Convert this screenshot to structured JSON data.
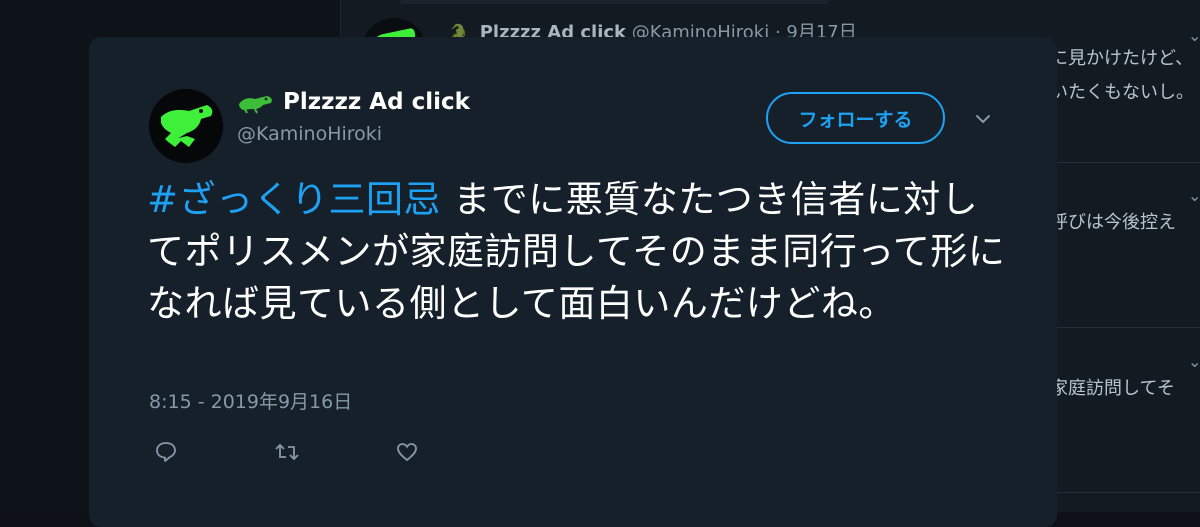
{
  "background": {
    "tweet": {
      "display_name": "Plzzzz Ad click",
      "handle": "@KaminoHiroki",
      "separator": "·",
      "date": "9月17日"
    },
    "snippets": [
      "に見かけたけど、",
      "いたくもないし。",
      "呼びは今後控え",
      "家庭訪問してそ"
    ]
  },
  "tweet": {
    "display_name": "Plzzzz Ad click",
    "handle": "@KaminoHiroki",
    "follow_label": "フォローする",
    "hashtag": "#ざっくり三回忌",
    "body": " までに悪質なたつき信者に対してポリスメンが家庭訪問してそのまま同行って形になれば見ている側として面白いんだけどね。",
    "timestamp": "8:15 - 2019年9月16日",
    "icons": {
      "avatar": "crocodile-avatar",
      "name_emoji": "crocodile-icon",
      "menu": "chevron-down-icon",
      "reply": "reply-icon",
      "retweet": "retweet-icon",
      "like": "heart-icon"
    }
  },
  "colors": {
    "card_bg": "#15202b",
    "accent": "#1da1f2",
    "secondary_text": "#8899a6",
    "avatar_green": "#3ef03a"
  }
}
